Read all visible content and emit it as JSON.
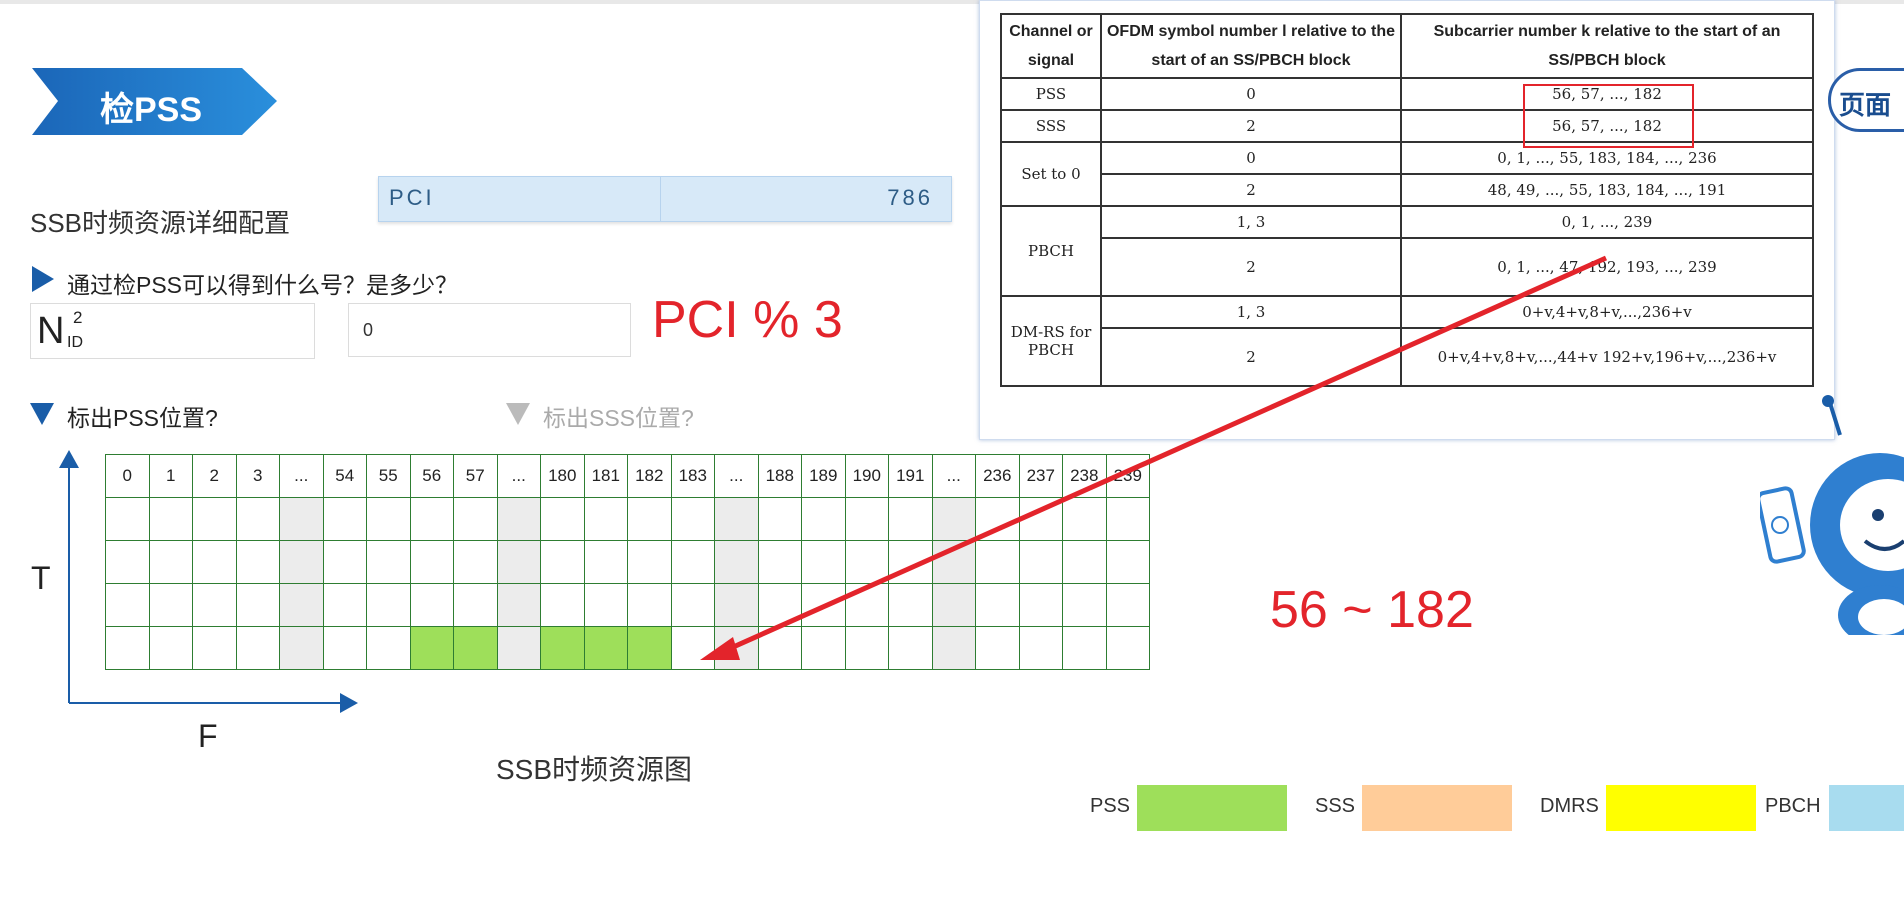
{
  "banner": {
    "title": "检PSS"
  },
  "section_label": "SSB时频资源详细配置",
  "pci_field": {
    "label": "PCI",
    "value": "786"
  },
  "question1": {
    "text": "通过检PSS可以得到什么号？是多少？",
    "nid_symbol": "N",
    "nid_sup": "2",
    "nid_sub": "ID",
    "answer": "0"
  },
  "formula": "PCI % 3",
  "question2": {
    "text": "标出PSS位置?"
  },
  "question3": {
    "text": "标出SSS位置?"
  },
  "grid": {
    "columns": [
      "0",
      "1",
      "2",
      "3",
      "...",
      "54",
      "55",
      "56",
      "57",
      "...",
      "180",
      "181",
      "182",
      "183",
      "...",
      "188",
      "189",
      "190",
      "191",
      "...",
      "236",
      "237",
      "238",
      "239"
    ],
    "pss_columns": [
      "56",
      "57",
      "180",
      "181",
      "182"
    ]
  },
  "axes": {
    "t_label": "T",
    "f_label": "F"
  },
  "figure_caption": "SSB时频资源图",
  "pss_range": "56 ~ 182",
  "legend": [
    {
      "label": "PSS",
      "color": "#9edf5a"
    },
    {
      "label": "SSS",
      "color": "#ffcc99"
    },
    {
      "label": "DMRS",
      "color": "#ffff00"
    },
    {
      "label": "PBCH",
      "color": "#a8dcef"
    }
  ],
  "ref_table": {
    "headers": [
      "Channel or signal",
      "OFDM symbol number l relative to the start of an SS/PBCH block",
      "Subcarrier number k relative to the start of an SS/PBCH block"
    ],
    "rows": [
      {
        "channel": "PSS",
        "symbol": "0",
        "subcarrier": "56, 57, ..., 182"
      },
      {
        "channel": "SSS",
        "symbol": "2",
        "subcarrier": "56, 57, ..., 182"
      },
      {
        "channel": "Set to 0",
        "symbol": "0",
        "subcarrier": "0, 1, ..., 55, 183, 184, ..., 236"
      },
      {
        "channel": "",
        "symbol": "2",
        "subcarrier": "48, 49, ..., 55, 183, 184, ..., 191"
      },
      {
        "channel": "PBCH",
        "symbol": "1, 3",
        "subcarrier": "0, 1, ..., 239"
      },
      {
        "channel": "",
        "symbol": "2",
        "subcarrier": "0, 1, ..., 47, 192, 193, ..., 239"
      },
      {
        "channel": "DM-RS for PBCH",
        "symbol": "1, 3",
        "subcarrier": "0+v,4+v,8+v,...,236+v"
      },
      {
        "channel": "",
        "symbol": "2",
        "subcarrier": "0+v,4+v,8+v,...,44+v 192+v,196+v,...,236+v"
      }
    ]
  },
  "page_button": {
    "label": "页面"
  }
}
